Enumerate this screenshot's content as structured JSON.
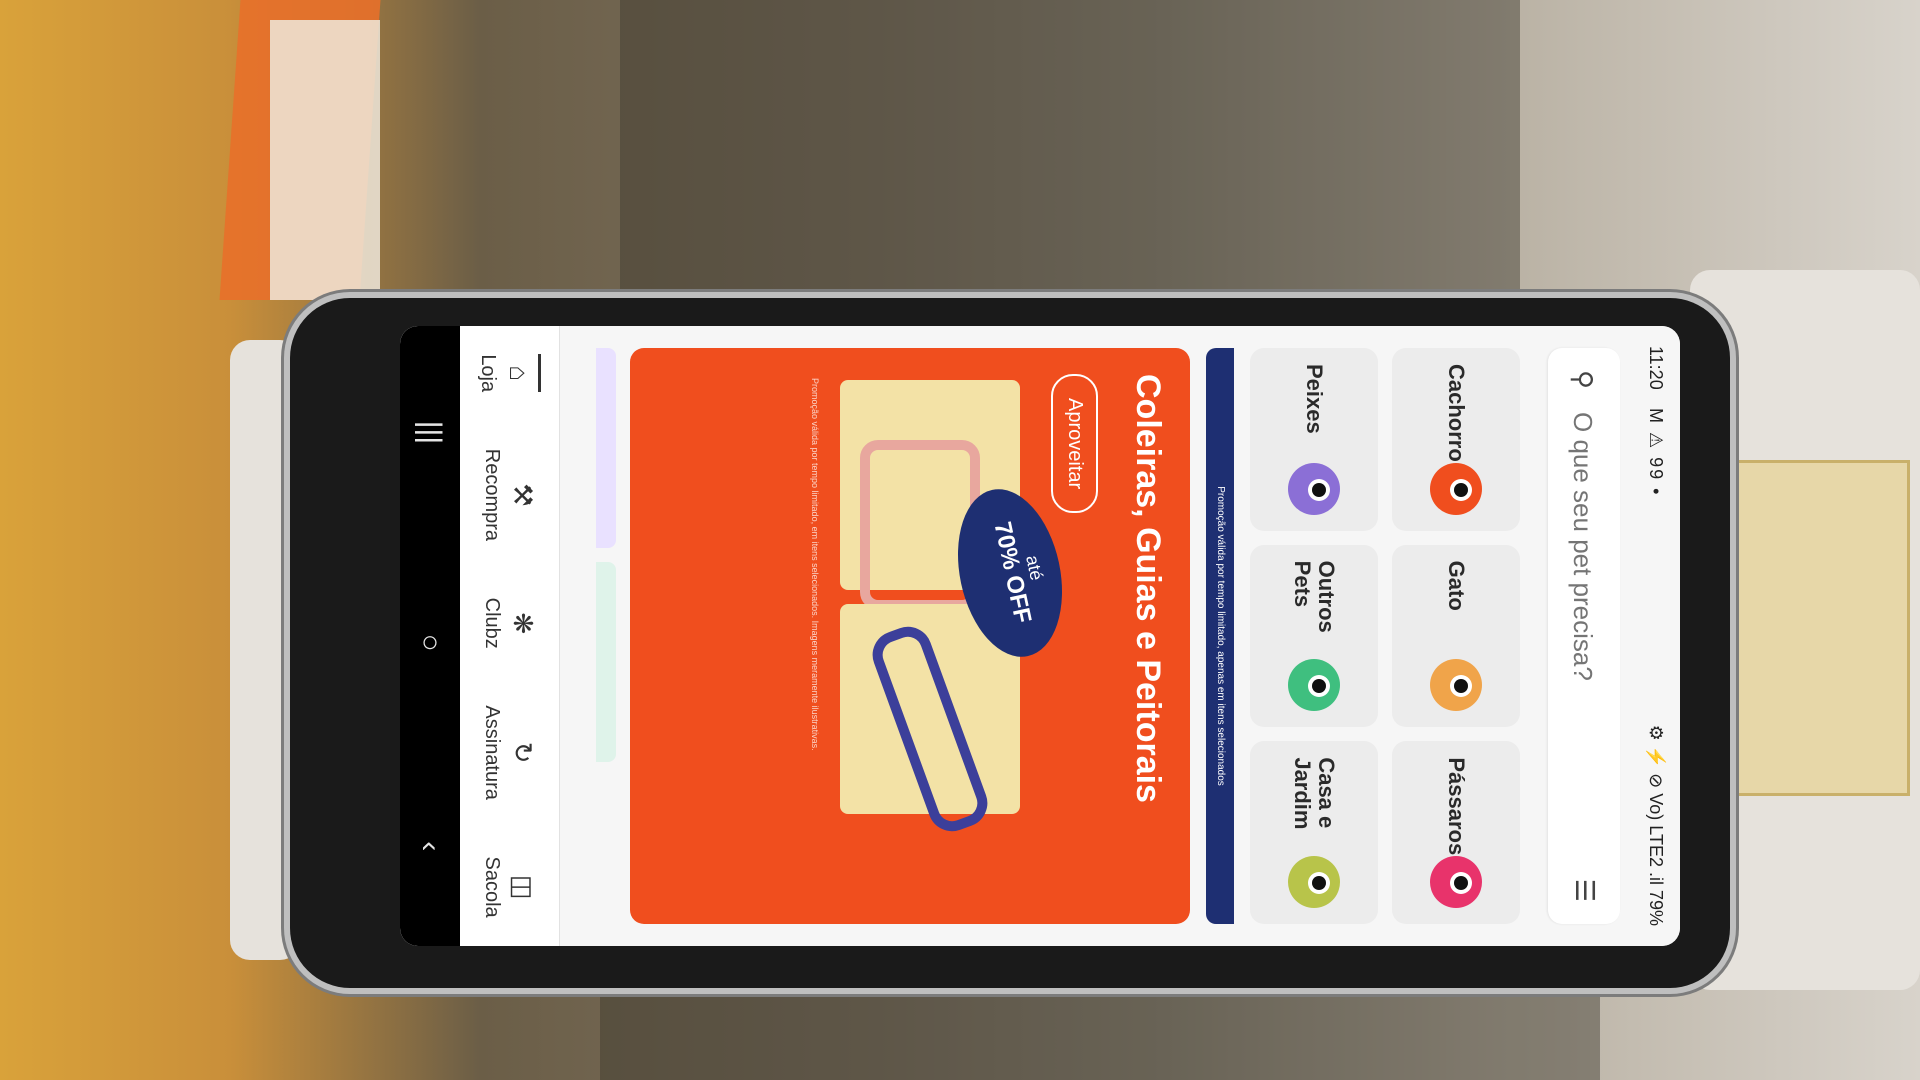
{
  "status_bar": {
    "time": "11:20",
    "left_icons": "M ⚠ 99 •",
    "right_text": "⚙ ⚡ ⊘ Vo) LTE2 .il 79%"
  },
  "search": {
    "placeholder": "O que seu pet precisa?",
    "icon": "search-icon",
    "list_icon": "list-icon"
  },
  "categories": [
    {
      "label": "Cachorro",
      "icon": "dog-icon",
      "color": "#f04e1e"
    },
    {
      "label": "Gato",
      "icon": "cat-icon",
      "color": "#f0a44a"
    },
    {
      "label": "Pássaros",
      "icon": "bird-icon",
      "color": "#e8336b"
    },
    {
      "label": "Peixes",
      "icon": "fish-icon",
      "color": "#8b6fd6"
    },
    {
      "label": "Outros Pets",
      "icon": "other-pets-icon",
      "color": "#3fbf7f"
    },
    {
      "label": "Casa e Jardim",
      "icon": "garden-icon",
      "color": "#b8c44a"
    }
  ],
  "promo_strip": "Promoção válida por tempo limitado, apenas em itens selecionados",
  "banner": {
    "title": "Coleiras, Guias e Peitorais",
    "button": "Aproveitar",
    "badge_prefix": "até",
    "badge_value": "70% OFF",
    "fine_print": "Promoção válida por tempo limitado, em itens selecionados. Imagens meramente ilustrativas."
  },
  "tabs": [
    {
      "label": "Loja",
      "icon": "store-icon",
      "active": true
    },
    {
      "label": "Recompra",
      "icon": "repurchase-icon"
    },
    {
      "label": "Clubz",
      "icon": "club-icon"
    },
    {
      "label": "Assinatura",
      "icon": "subscription-icon"
    },
    {
      "label": "Sacola",
      "icon": "bag-icon"
    }
  ],
  "nav_bar": {
    "recents": "|||",
    "home": "○",
    "back": "‹"
  },
  "colors": {
    "accent": "#f04e1e",
    "badge": "#1e2f72"
  }
}
